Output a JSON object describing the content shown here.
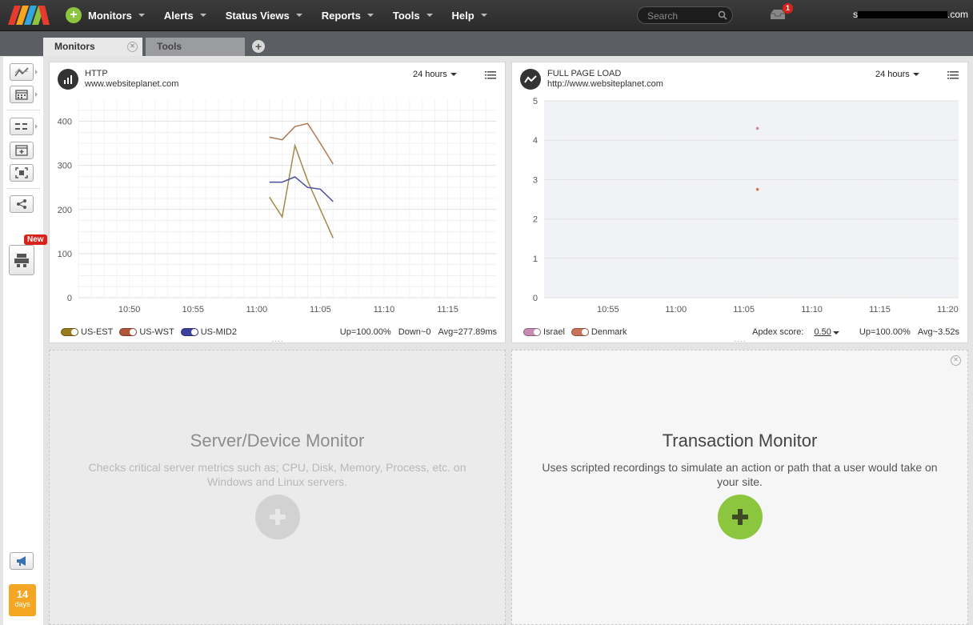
{
  "topbar": {
    "nav": [
      {
        "label": "Monitors"
      },
      {
        "label": "Alerts"
      },
      {
        "label": "Status Views"
      },
      {
        "label": "Reports"
      },
      {
        "label": "Tools"
      },
      {
        "label": "Help"
      }
    ],
    "search_placeholder": "Search",
    "inbox_count": "1",
    "user_prefix": "s",
    "user_suffix": ".com"
  },
  "tabs": [
    {
      "label": "Monitors",
      "active": true
    },
    {
      "label": "Tools",
      "active": false
    }
  ],
  "sidebar": {
    "new_badge": "New",
    "trial_days": "14",
    "trial_label": "days"
  },
  "http_panel": {
    "type": "HTTP",
    "url": "www.websiteplanet.com",
    "range": "24 hours",
    "legend": [
      {
        "name": "US-EST",
        "color": "#9a7b1e"
      },
      {
        "name": "US-WST",
        "color": "#b0553a"
      },
      {
        "name": "US-MID2",
        "color": "#3b3f9e"
      }
    ],
    "up": "Up=100.00%",
    "down": "Down~0",
    "avg": "Avg=277.89ms"
  },
  "fpl_panel": {
    "type": "FULL PAGE LOAD",
    "url": "http://www.websiteplanet.com",
    "range": "24 hours",
    "legend": [
      {
        "name": "Israel",
        "color": "#c98ab2"
      },
      {
        "name": "Denmark",
        "color": "#c9735a"
      }
    ],
    "apdex_label": "Apdex score:",
    "apdex_value": "0.50",
    "up": "Up=100.00%",
    "avg": "Avg~3.52s"
  },
  "server_card": {
    "title": "Server/Device Monitor",
    "desc": "Checks critical server metrics such as; CPU, Disk, Memory, Process, etc. on Windows and Linux servers."
  },
  "transaction_card": {
    "title": "Transaction Monitor",
    "desc": "Uses scripted recordings to simulate an action or path that a user would take on your site."
  },
  "chart_data": [
    {
      "type": "line",
      "title": "HTTP",
      "xlabel": "",
      "ylabel": "",
      "x_ticks": [
        "10:50",
        "10:55",
        "11:00",
        "11:05",
        "11:10",
        "11:15"
      ],
      "ylim": [
        0,
        450
      ],
      "y_ticks": [
        0,
        100,
        200,
        300,
        400
      ],
      "grid": true,
      "series": [
        {
          "name": "US-EST",
          "color": "#a08a45",
          "x": [
            "11:01",
            "11:02",
            "11:03",
            "11:04",
            "11:05",
            "11:06"
          ],
          "values": [
            228,
            183,
            345,
            265,
            200,
            135
          ]
        },
        {
          "name": "US-WST",
          "color": "#b07850",
          "x": [
            "11:01",
            "11:02",
            "11:03",
            "11:04",
            "11:05",
            "11:06"
          ],
          "values": [
            364,
            358,
            388,
            395,
            350,
            303
          ]
        },
        {
          "name": "US-MID2",
          "color": "#4a4e9c",
          "x": [
            "11:01",
            "11:02",
            "11:03",
            "11:04",
            "11:05",
            "11:06"
          ],
          "values": [
            262,
            262,
            274,
            250,
            246,
            218
          ]
        }
      ]
    },
    {
      "type": "scatter",
      "title": "FULL PAGE LOAD",
      "xlabel": "",
      "ylabel": "",
      "x_ticks": [
        "10:55",
        "11:00",
        "11:05",
        "11:10",
        "11:15",
        "11:20"
      ],
      "ylim": [
        0,
        5
      ],
      "y_ticks": [
        0,
        1,
        2,
        3,
        4,
        5
      ],
      "grid": true,
      "series": [
        {
          "name": "Israel",
          "color": "#c98ab2",
          "x": [
            "11:06"
          ],
          "values": [
            4.3
          ]
        },
        {
          "name": "Denmark",
          "color": "#d07a5a",
          "x": [
            "11:06"
          ],
          "values": [
            2.75
          ]
        }
      ]
    }
  ]
}
